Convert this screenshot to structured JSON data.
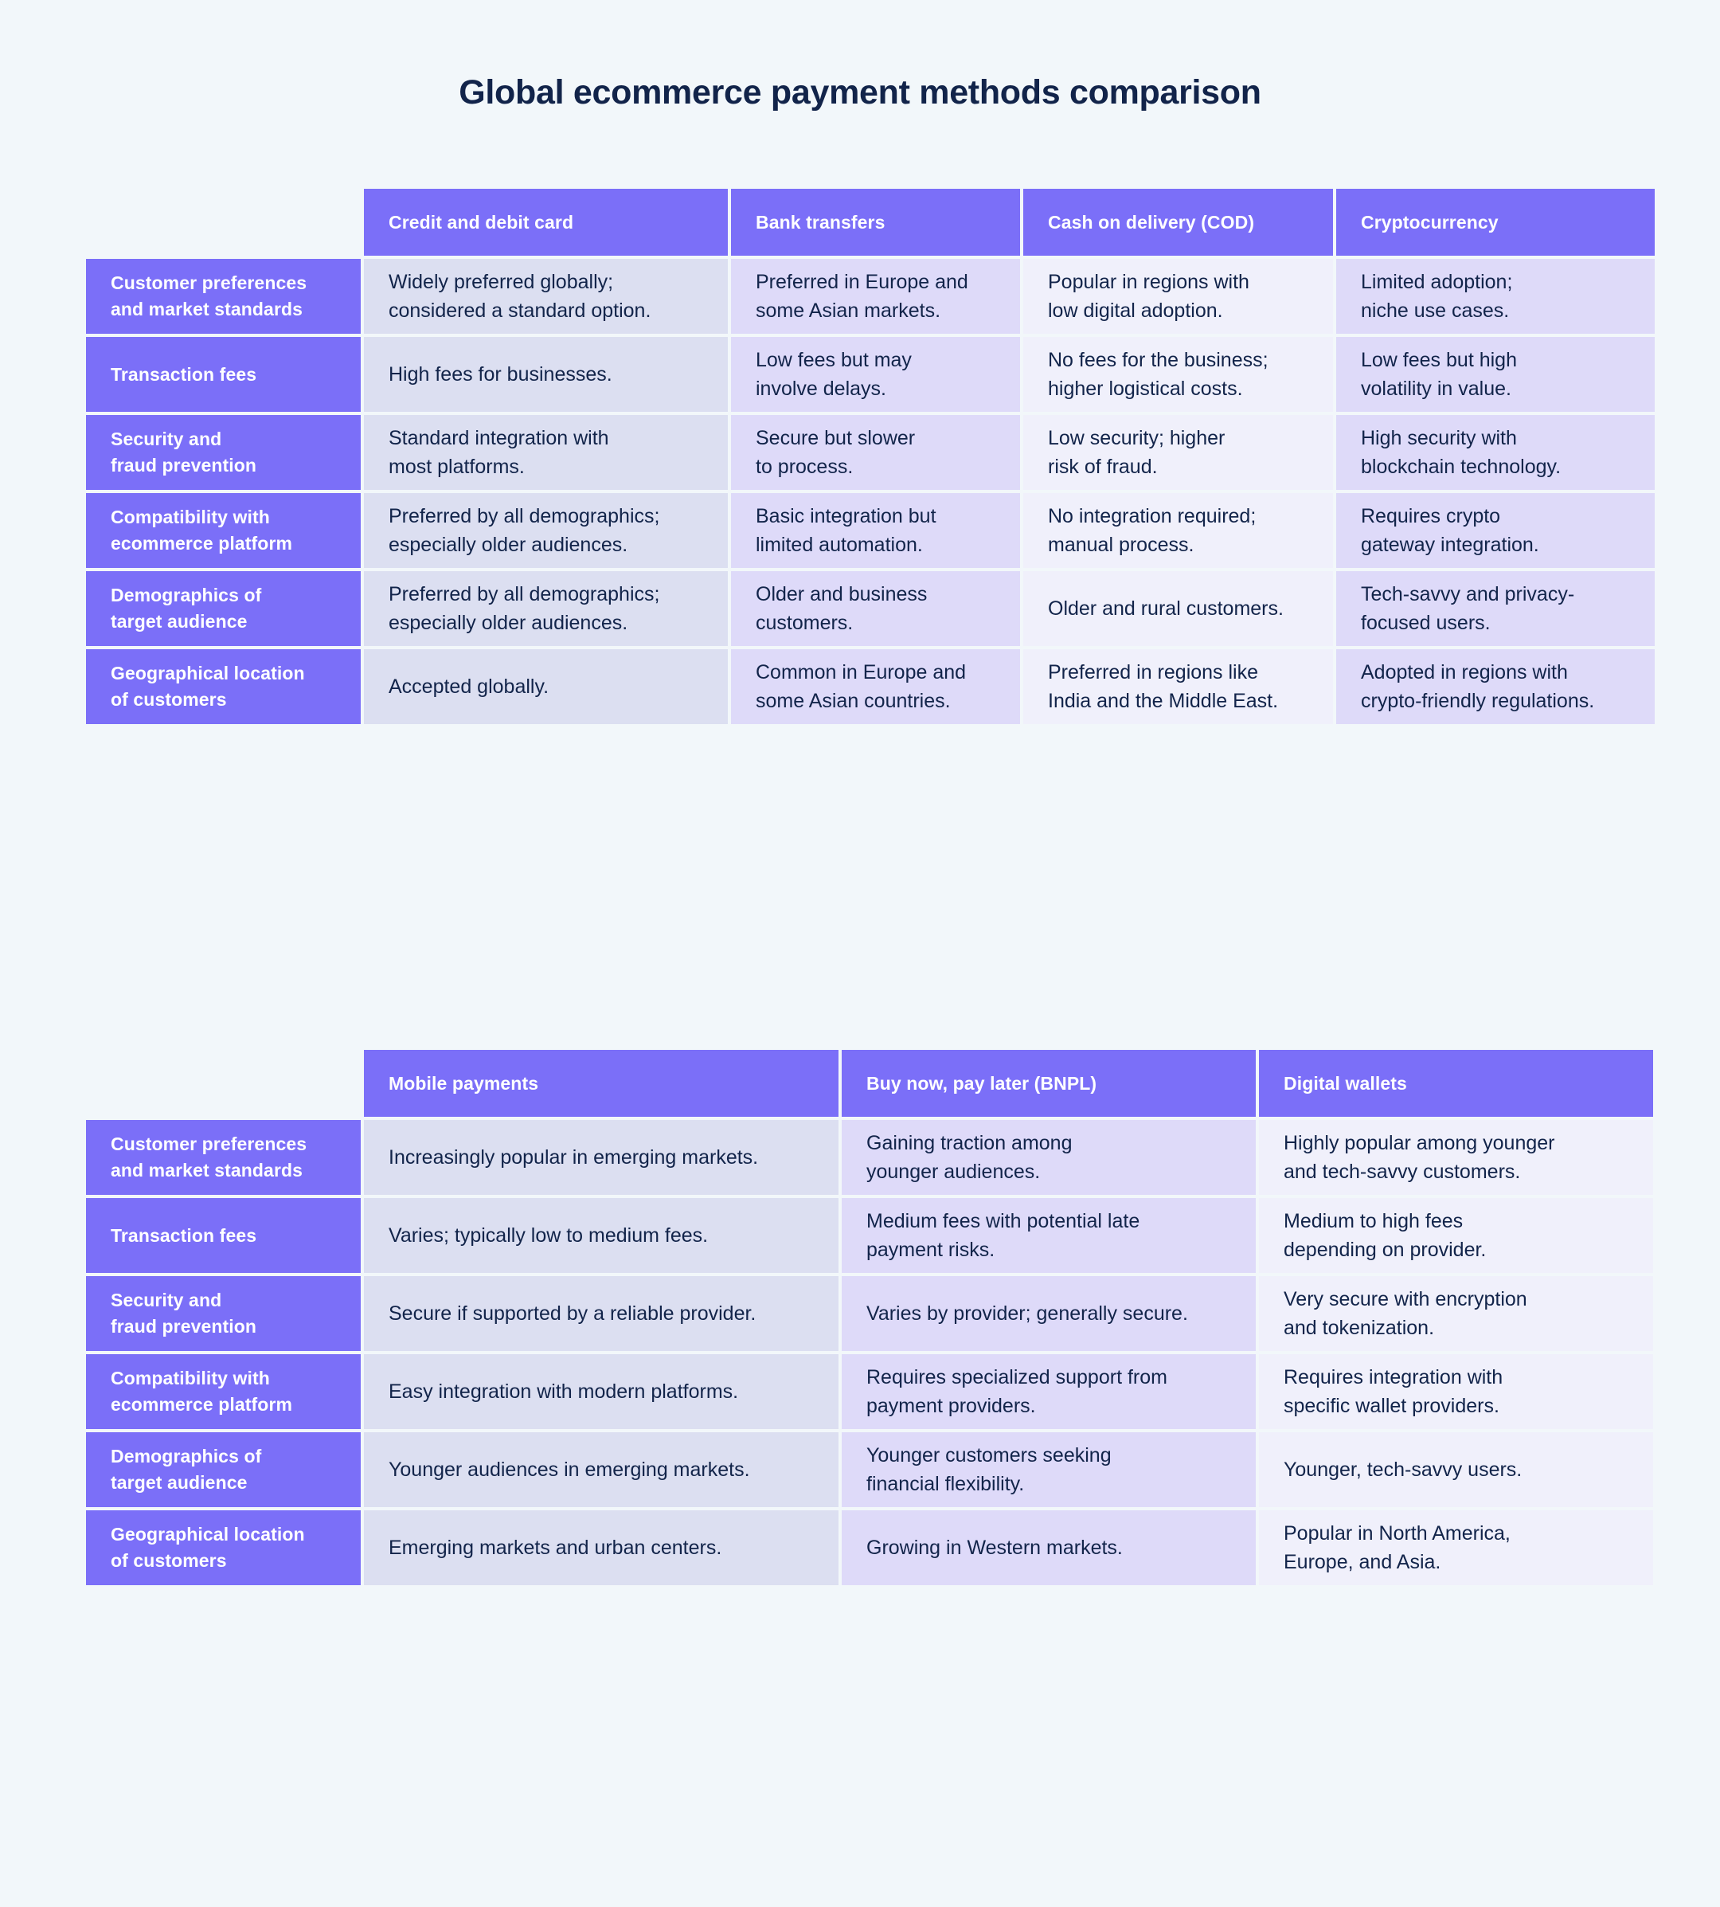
{
  "page": {
    "title": "Global ecommerce payment methods comparison",
    "background_color": "#f2f7fa",
    "accent_color": "#7b6ff8",
    "text_color": "#12244a"
  },
  "tables": [
    {
      "id": "table-1",
      "columns": [
        "Credit and debit card",
        "Bank transfers",
        "Cash on delivery (COD)",
        "Cryptocurrency"
      ],
      "rows": [
        {
          "label": "Customer preferences\nand market standards",
          "cells": [
            "Widely preferred globally;\nconsidered a standard option.",
            "Preferred in Europe and\nsome Asian markets.",
            "Popular in regions with\nlow digital adoption.",
            "Limited adoption;\nniche use cases."
          ]
        },
        {
          "label": "Transaction fees",
          "cells": [
            "High fees for businesses.",
            "Low fees but may\ninvolve delays.",
            "No fees for the business;\nhigher logistical costs.",
            "Low fees but high\nvolatility in value."
          ]
        },
        {
          "label": "Security and\nfraud prevention",
          "cells": [
            "Standard integration with\nmost platforms.",
            "Secure but slower\nto process.",
            "Low security; higher\nrisk of fraud.",
            "High security with\nblockchain technology."
          ]
        },
        {
          "label": "Compatibility with\necommerce platform",
          "cells": [
            "Preferred by all demographics;\nespecially older audiences.",
            "Basic integration but\nlimited automation.",
            "No integration required;\nmanual process.",
            "Requires crypto\ngateway integration."
          ]
        },
        {
          "label": "Demographics of\ntarget audience",
          "cells": [
            "Preferred by all demographics;\nespecially older audiences.",
            "Older and business\ncustomers.",
            "Older and rural customers.",
            "Tech-savvy and privacy-\nfocused users."
          ]
        },
        {
          "label": "Geographical location\nof customers",
          "cells": [
            "Accepted globally.",
            "Common in Europe and\nsome Asian countries.",
            "Preferred in regions like\nIndia and the Middle East.",
            "Adopted in regions with\ncrypto-friendly regulations."
          ]
        }
      ]
    },
    {
      "id": "table-2",
      "columns": [
        "Mobile payments",
        "Buy now, pay later (BNPL)",
        "Digital wallets"
      ],
      "rows": [
        {
          "label": "Customer preferences\nand market standards",
          "cells": [
            "Increasingly popular in emerging markets.",
            "Gaining traction among\nyounger audiences.",
            "Highly popular among younger\nand tech-savvy customers."
          ]
        },
        {
          "label": "Transaction fees",
          "cells": [
            "Varies; typically low to medium fees.",
            "Medium fees with potential late\npayment risks.",
            "Medium to high fees\ndepending on provider."
          ]
        },
        {
          "label": "Security and\nfraud prevention",
          "cells": [
            "Secure if supported by a reliable provider.",
            "Varies by provider; generally secure.",
            "Very secure with encryption\nand tokenization."
          ]
        },
        {
          "label": "Compatibility with\necommerce platform",
          "cells": [
            "Easy integration with modern platforms.",
            "Requires specialized support from\npayment providers.",
            "Requires integration with\nspecific wallet providers."
          ]
        },
        {
          "label": "Demographics of\ntarget audience",
          "cells": [
            "Younger audiences in emerging markets.",
            "Younger customers seeking\nfinancial flexibility.",
            "Younger, tech-savvy users."
          ]
        },
        {
          "label": "Geographical location\nof customers",
          "cells": [
            "Emerging markets and urban centers.",
            "Growing in Western markets.",
            "Popular in North America,\nEurope, and Asia."
          ]
        }
      ]
    }
  ]
}
